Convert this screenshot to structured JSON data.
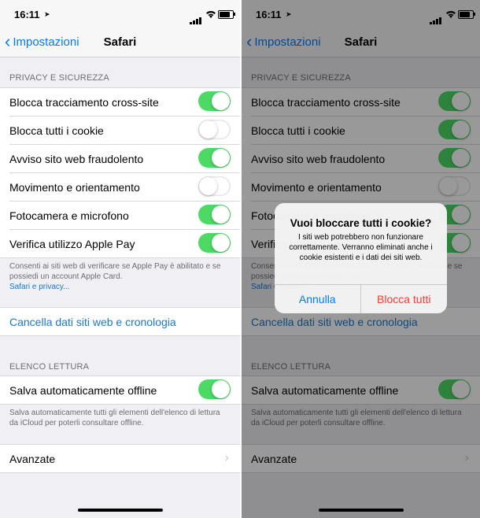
{
  "status": {
    "time": "16:11"
  },
  "nav": {
    "back_label": "Impostazioni",
    "title": "Safari"
  },
  "privacy": {
    "header": "PRIVACY E SICUREZZA",
    "items": [
      {
        "label": "Blocca tracciamento cross-site",
        "on": true
      },
      {
        "label": "Blocca tutti i cookie",
        "on": false
      },
      {
        "label": "Avviso sito web fraudolento",
        "on": true
      },
      {
        "label": "Movimento e orientamento",
        "on": false
      },
      {
        "label": "Fotocamera e microfono",
        "on": true
      },
      {
        "label": "Verifica utilizzo Apple Pay",
        "on": true
      }
    ],
    "footer": "Consenti ai siti web di verificare se Apple Pay è abilitato e se possiedi un account Apple Card.",
    "footer_link": "Safari e privacy..."
  },
  "clear_data": {
    "label": "Cancella dati siti web e cronologia"
  },
  "reading_list": {
    "header": "ELENCO LETTURA",
    "item": {
      "label": "Salva automaticamente offline",
      "on": true
    },
    "footer": "Salva automaticamente tutti gli elementi dell'elenco di lettura da iCloud per poterli consultare offline."
  },
  "advanced": {
    "label": "Avanzate"
  },
  "right_toggles": [
    true,
    true,
    true,
    false,
    true,
    true
  ],
  "alert": {
    "title": "Vuoi bloccare tutti i cookie?",
    "message": "I siti web potrebbero non funzionare correttamente. Verranno eliminati anche i cookie esistenti e i dati dei siti web.",
    "cancel_label": "Annulla",
    "confirm_label": "Blocca tutti"
  },
  "colors": {
    "toggle_on": "#4cd964",
    "link": "#007aff",
    "destructive": "#ff3b30"
  }
}
